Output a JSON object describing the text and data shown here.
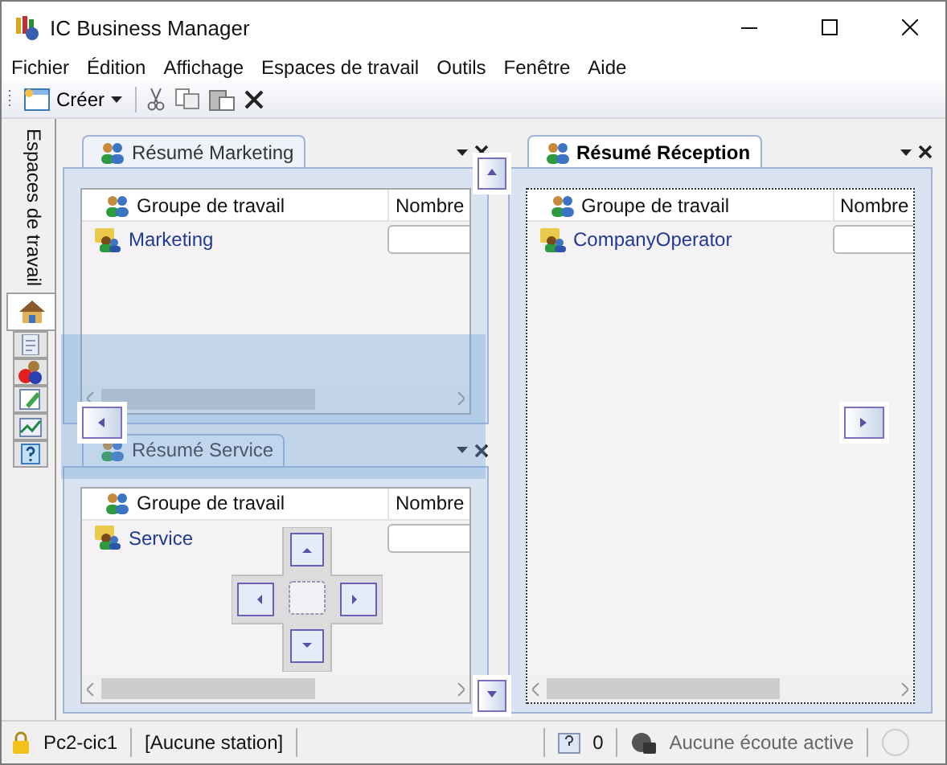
{
  "window": {
    "title": "IC Business Manager"
  },
  "menu": [
    "Fichier",
    "Édition",
    "Affichage",
    "Espaces de travail",
    "Outils",
    "Fenêtre",
    "Aide"
  ],
  "toolbar": {
    "create_label": "Créer"
  },
  "sidebar": {
    "label": "Espaces de travail",
    "tabs": [
      {
        "kind": "home",
        "selected": true
      },
      {
        "kind": "document",
        "selected": false
      },
      {
        "kind": "people",
        "selected": false
      },
      {
        "kind": "edit",
        "selected": false
      },
      {
        "kind": "chart",
        "selected": false
      },
      {
        "kind": "help",
        "selected": false
      }
    ]
  },
  "panels": [
    {
      "title": "Résumé Marketing",
      "active": false,
      "columns": [
        "Groupe de travail",
        "Nombre"
      ],
      "rows": [
        {
          "name": "Marketing"
        }
      ]
    },
    {
      "title": "Résumé Service",
      "active": false,
      "columns": [
        "Groupe de travail",
        "Nombre"
      ],
      "rows": [
        {
          "name": "Service"
        }
      ]
    },
    {
      "title": "Résumé Réception",
      "active": true,
      "columns": [
        "Groupe de travail",
        "Nombre"
      ],
      "rows": [
        {
          "name": "CompanyOperator"
        }
      ]
    }
  ],
  "status_bar": {
    "user": "Pc2-cic1",
    "station": "[Aucune station]",
    "count": "0",
    "listen": "Aucune écoute active"
  }
}
